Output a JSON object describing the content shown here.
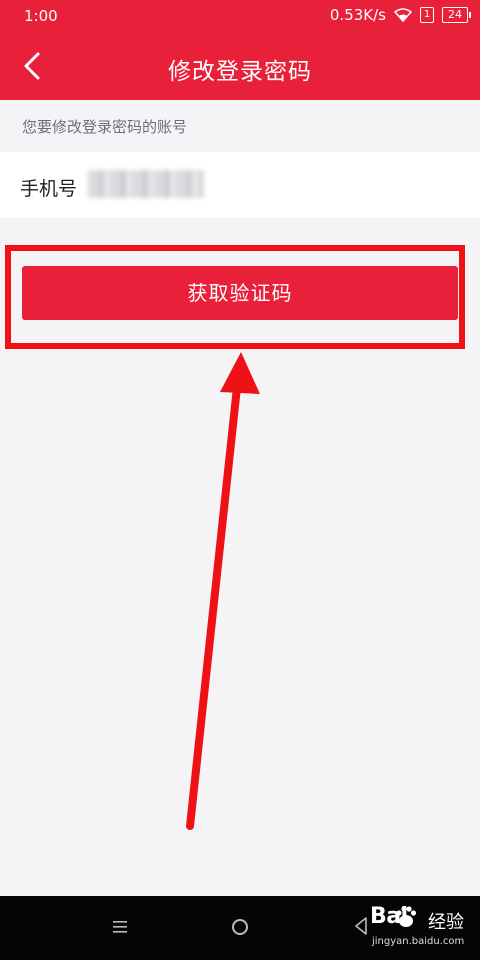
{
  "status_bar": {
    "time": "1:00",
    "network_speed": "0.53K/s",
    "sim_label": "1",
    "battery": "24"
  },
  "header": {
    "title": "修改登录密码",
    "back_icon": "chevron-left-icon",
    "background": "#e8203a"
  },
  "account_hint": "您要修改登录密码的账号",
  "phone_field": {
    "label": "手机号"
  },
  "primary_button": {
    "label": "获取验证码",
    "color": "#e8203a"
  },
  "annotation": {
    "color": "#ee1115"
  },
  "nav_bar": {
    "menu_icon": "menu-icon",
    "home_icon": "home-circle-icon",
    "back_icon": "back-triangle-icon"
  },
  "watermark": {
    "logo": "Bai",
    "brand": "经验",
    "url": "jingyan.baidu.com"
  }
}
